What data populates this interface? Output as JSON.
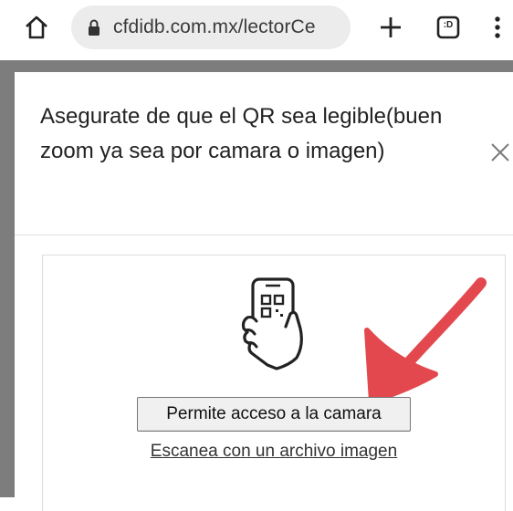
{
  "browser": {
    "url": "cfdidb.com.mx/lectorCe",
    "tab_count": ":D"
  },
  "dialog": {
    "title": "Asegurate de que el QR sea legible(buen zoom ya sea por camara o imagen)"
  },
  "scanner": {
    "camera_button_label": "Permite acceso a la camara",
    "file_link_label": "Escanea con un archivo imagen"
  },
  "colors": {
    "overlay": "#7d7d7d",
    "arrow": "#e2484d"
  }
}
